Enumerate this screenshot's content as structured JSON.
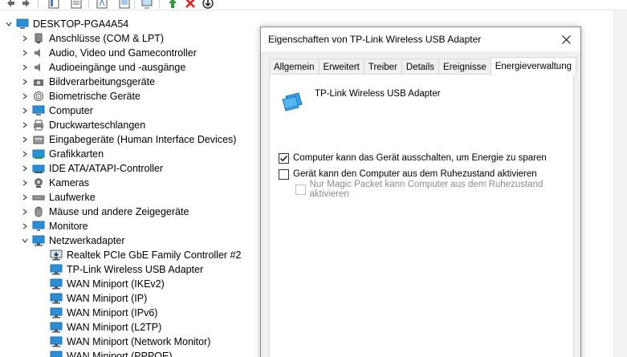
{
  "toolbar": {
    "buttons": [
      "back-icon",
      "forward-icon",
      "properties-icon",
      "help-icon",
      "driver-icon",
      "monitor-icon",
      "update-driver-icon",
      "uninstall-icon",
      "scan-icon"
    ]
  },
  "tree": {
    "root": "DESKTOP-PGA4A54",
    "categories": [
      {
        "label": "Anschlüsse (COM & LPT)",
        "icon": "port-icon"
      },
      {
        "label": "Audio, Video und Gamecontroller",
        "icon": "speaker-icon"
      },
      {
        "label": "Audioeingänge und -ausgänge",
        "icon": "speaker-icon"
      },
      {
        "label": "Bildverarbeitungsgeräte",
        "icon": "camera-icon"
      },
      {
        "label": "Biometrische Geräte",
        "icon": "fingerprint-icon"
      },
      {
        "label": "Computer",
        "icon": "computer-icon"
      },
      {
        "label": "Druckwarteschlangen",
        "icon": "printer-icon"
      },
      {
        "label": "Eingabegeräte (Human Interface Devices)",
        "icon": "hid-icon"
      },
      {
        "label": "Grafikkarten",
        "icon": "display-adapter-icon"
      },
      {
        "label": "IDE ATA/ATAPI-Controller",
        "icon": "ide-icon"
      },
      {
        "label": "Kameras",
        "icon": "webcam-icon"
      },
      {
        "label": "Laufwerke",
        "icon": "drive-icon"
      },
      {
        "label": "Mäuse und andere Zeigegeräte",
        "icon": "mouse-icon"
      },
      {
        "label": "Monitore",
        "icon": "monitor-icon"
      },
      {
        "label": "Netzwerkadapter",
        "icon": "network-icon"
      }
    ],
    "network_children": [
      "Realtek PCIe GbE Family Controller #2",
      "TP-Link Wireless USB Adapter",
      "WAN Miniport (IKEv2)",
      "WAN Miniport (IP)",
      "WAN Miniport (IPv6)",
      "WAN Miniport (L2TP)",
      "WAN Miniport (Network Monitor)",
      "WAN Miniport (PPPOE)"
    ]
  },
  "dialog": {
    "title": "Eigenschaften von TP-Link Wireless USB Adapter",
    "tabs": [
      "Allgemein",
      "Erweitert",
      "Treiber",
      "Details",
      "Ereignisse",
      "Energieverwaltung"
    ],
    "active_tab": "Energieverwaltung",
    "device_name": "TP-Link Wireless USB Adapter",
    "options": [
      {
        "label": "Computer kann das Gerät ausschalten, um Energie zu sparen",
        "checked": true,
        "enabled": true
      },
      {
        "label": "Gerät kann den Computer aus dem Ruhezustand aktivieren",
        "checked": false,
        "enabled": true
      },
      {
        "label": "Nur Magic Packet kann Computer aus dem Ruhezustand aktivieren",
        "checked": false,
        "enabled": false
      }
    ]
  },
  "colors": {
    "accent_blue": "#1f78c8",
    "net_icon_blue": "#2b8fd6",
    "disabled_text": "#8c8c8c",
    "uninstall_red": "#e0201a",
    "update_green": "#2e9a3a"
  }
}
